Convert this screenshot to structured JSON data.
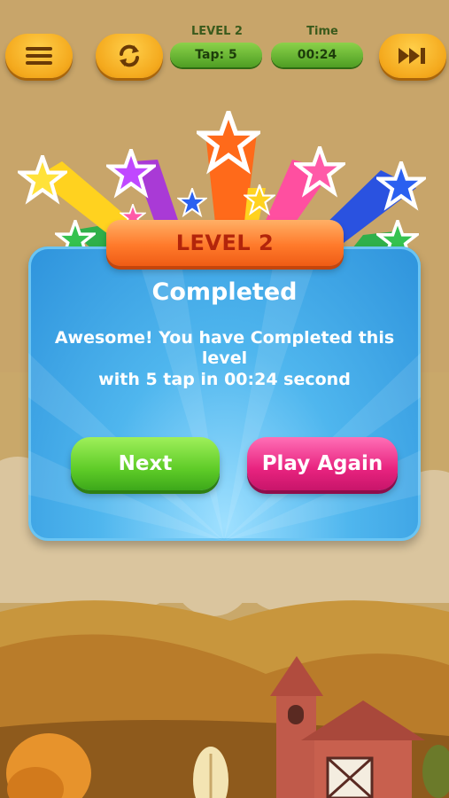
{
  "topbar": {
    "menu_icon": "hamburger-menu-icon",
    "restart_icon": "restart-icon",
    "skip_icon": "fast-forward-icon",
    "level_label": "LEVEL 2",
    "tap_value": "Tap: 5",
    "time_label": "Time",
    "time_value": "00:24"
  },
  "dialog": {
    "ribbon_label": "LEVEL 2",
    "title": "Completed",
    "message_line1": "Awesome! You have Completed this",
    "message_line2": "level",
    "message_line3": "with 5 tap in 00:24 second",
    "next_label": "Next",
    "play_again_label": "Play Again"
  },
  "colors": {
    "accent_orange": "#ff7a2b",
    "next_green": "#5fcc28",
    "play_again_pink": "#e8237f",
    "panel_blue": "#4fb6ee"
  }
}
